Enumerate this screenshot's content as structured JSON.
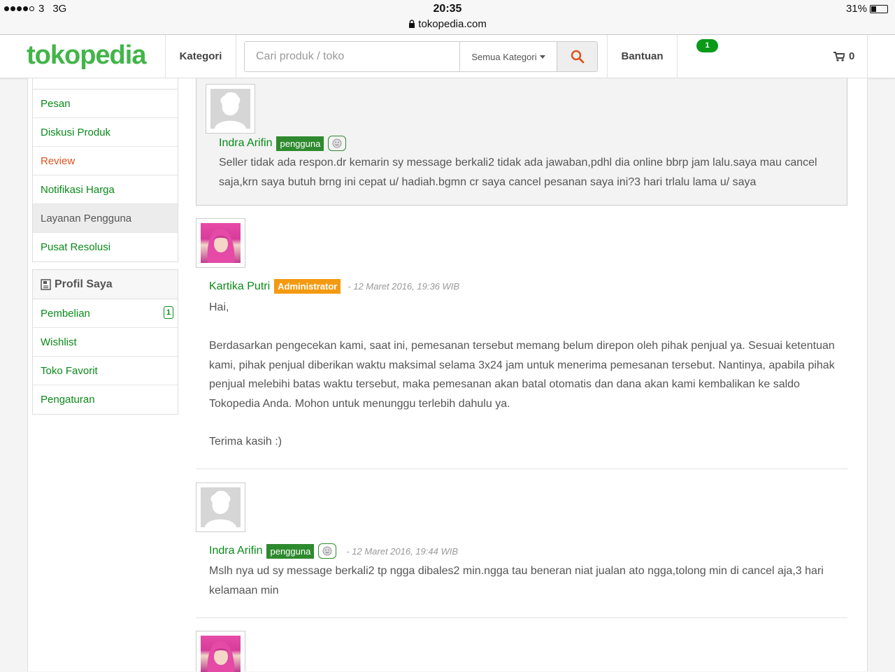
{
  "status_bar": {
    "carrier": "3",
    "network": "3G",
    "time": "20:35",
    "url": "tokopedia.com",
    "battery": "31%"
  },
  "header": {
    "logo": "tokopedia",
    "kategori_label": "Kategori",
    "search_placeholder": "Cari produk / toko",
    "search_category": "Semua Kategori",
    "bantuan_label": "Bantuan",
    "message_count": "1",
    "cart_count": "0"
  },
  "sidebar": {
    "top_items": [
      {
        "label": "Pesan"
      },
      {
        "label": "Diskusi Produk"
      },
      {
        "label": "Review"
      },
      {
        "label": "Notifikasi Harga"
      },
      {
        "label": "Layanan Pengguna"
      },
      {
        "label": "Pusat Resolusi"
      }
    ],
    "profile_heading": "Profil Saya",
    "profile_items": [
      {
        "label": "Pembelian",
        "badge": "1"
      },
      {
        "label": "Wishlist"
      },
      {
        "label": "Toko Favorit"
      },
      {
        "label": "Pengaturan"
      }
    ]
  },
  "comments": [
    {
      "name": "Indra Arifin",
      "role": "pengguna",
      "date": "",
      "text": "Seller tidak ada respon.dr kemarin sy message berkali2 tidak ada jawaban,pdhl dia online bbrp jam lalu.saya mau cancel saja,krn saya butuh brng ini cepat u/ hadiah.bgmn cr saya cancel pesanan saya ini?3 hari trlalu lama u/ saya"
    },
    {
      "name": "Kartika Putri",
      "role": "Administrator",
      "date": "- 12 Maret 2016, 19:36 WIB",
      "greeting": "Hai,",
      "text": "Berdasarkan pengecekan kami, saat ini, pemesanan tersebut memang belum direpon oleh pihak penjual ya. Sesuai ketentuan kami, pihak penjual diberikan waktu maksimal selama 3x24 jam untuk menerima pemesanan tersebut. Nantinya, apabila pihak penjual melebihi batas waktu tersebut, maka pemesanan akan batal otomatis dan dana akan kami kembalikan ke saldo Tokopedia Anda. Mohon untuk menunggu terlebih dahulu ya.",
      "closing": "Terima kasih :)"
    },
    {
      "name": "Indra Arifin",
      "role": "pengguna",
      "date": "- 12 Maret 2016, 19:44 WIB",
      "text": "Mslh nya ud sy message berkali2 tp ngga dibales2 min.ngga tau beneran niat jualan ato ngga,tolong min di cancel aja,3 hari kelamaan min"
    }
  ],
  "colors": {
    "brand_green": "#42b549",
    "link_green": "#0a8a1a",
    "active_orange": "#e0541f",
    "admin_orange": "#f39a12"
  }
}
